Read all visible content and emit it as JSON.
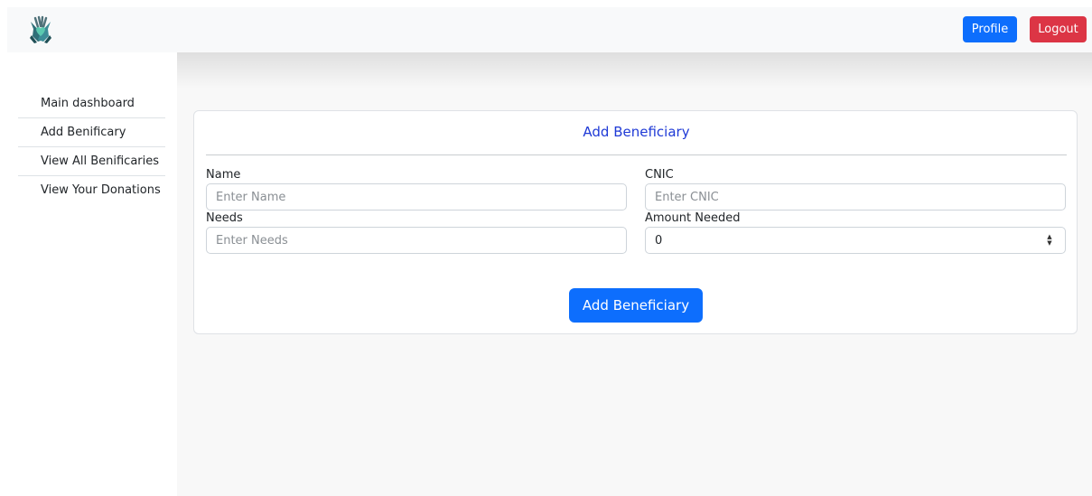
{
  "header": {
    "logo_icon": "hands-heart-logo-icon",
    "profile_label": "Profile",
    "logout_label": "Logout",
    "colors": {
      "primary": "#0d6efd",
      "danger": "#dc3545"
    }
  },
  "sidebar": {
    "items": [
      {
        "label": "Main dashboard"
      },
      {
        "label": "Add Benificary"
      },
      {
        "label": "View All Benificaries"
      },
      {
        "label": "View Your Donations"
      }
    ]
  },
  "form": {
    "title": "Add Beneficiary",
    "fields": {
      "name": {
        "label": "Name",
        "placeholder": "Enter Name",
        "value": ""
      },
      "cnic": {
        "label": "CNIC",
        "placeholder": "Enter CNIC",
        "value": ""
      },
      "needs": {
        "label": "Needs",
        "placeholder": "Enter Needs",
        "value": ""
      },
      "amount": {
        "label": "Amount Needed",
        "placeholder": "",
        "value": "0"
      }
    },
    "submit_label": "Add Beneficiary",
    "title_color": "#1f3ad6"
  }
}
